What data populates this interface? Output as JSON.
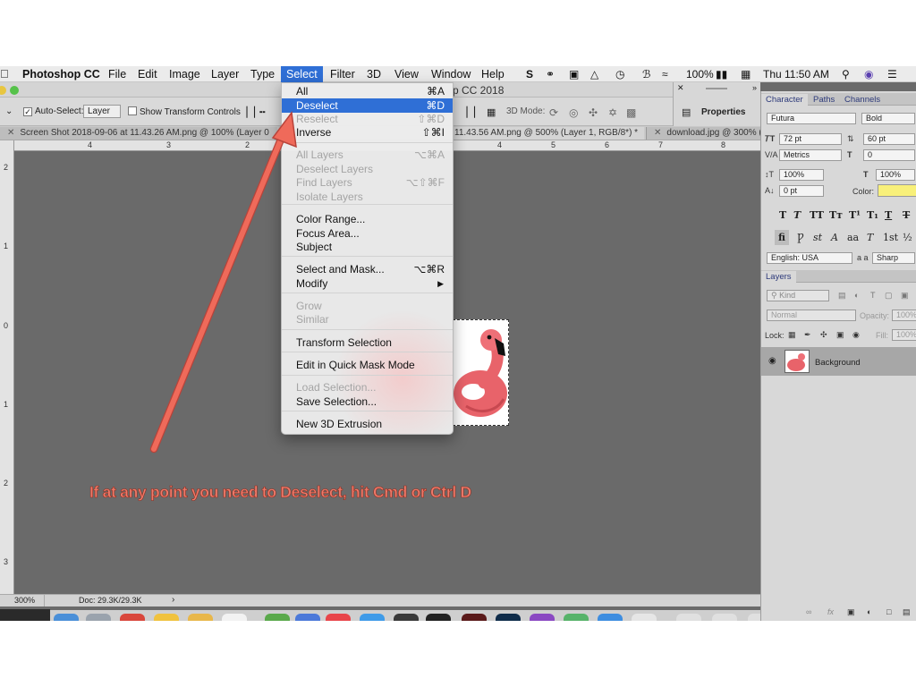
{
  "menubar": {
    "app_name": "Photoshop CC",
    "items": [
      "File",
      "Edit",
      "Image",
      "Layer",
      "Type",
      "Select",
      "Filter",
      "3D",
      "View",
      "Window",
      "Help"
    ],
    "battery": "100%",
    "clock": "Thu 11:50 AM"
  },
  "window": {
    "title_fragment": "p CC 2018"
  },
  "options_bar": {
    "auto_select_label": "Auto-Select:",
    "auto_select_value": "Layer",
    "show_transform_label": "Show Transform Controls",
    "mode_3d_label": "3D Mode:"
  },
  "tabs": [
    {
      "label": "Screen Shot 2018-09-06 at 11.43.26 AM.png @ 100% (Layer 0"
    },
    {
      "label": "11.43.56 AM.png @ 500% (Layer 1, RGB/8*) *"
    },
    {
      "label": "download.jpg @ 300% ("
    }
  ],
  "ruler": {
    "top_ticks": [
      "4",
      "3",
      "2",
      "4",
      "5",
      "6",
      "7",
      "8"
    ],
    "left_ticks": [
      "2",
      "1",
      "0",
      "1",
      "2",
      "3"
    ]
  },
  "properties_panel": {
    "label": "Properties"
  },
  "select_menu": {
    "items": [
      {
        "label": "All",
        "shortcut": "⌘A",
        "state": "normal"
      },
      {
        "label": "Deselect",
        "shortcut": "⌘D",
        "state": "highlighted"
      },
      {
        "label": "Reselect",
        "shortcut": "⇧⌘D",
        "state": "disabled"
      },
      {
        "label": "Inverse",
        "shortcut": "⇧⌘I",
        "state": "normal"
      },
      {
        "label": "All Layers",
        "shortcut": "⌥⌘A",
        "state": "disabled"
      },
      {
        "label": "Deselect Layers",
        "shortcut": "",
        "state": "disabled"
      },
      {
        "label": "Find Layers",
        "shortcut": "⌥⇧⌘F",
        "state": "disabled"
      },
      {
        "label": "Isolate Layers",
        "shortcut": "",
        "state": "disabled"
      },
      {
        "label": "Color Range...",
        "shortcut": "",
        "state": "normal"
      },
      {
        "label": "Focus Area...",
        "shortcut": "",
        "state": "normal"
      },
      {
        "label": "Subject",
        "shortcut": "",
        "state": "normal"
      },
      {
        "label": "Select and Mask...",
        "shortcut": "⌥⌘R",
        "state": "normal"
      },
      {
        "label": "Modify",
        "shortcut": "",
        "state": "submenu"
      },
      {
        "label": "Grow",
        "shortcut": "",
        "state": "disabled"
      },
      {
        "label": "Similar",
        "shortcut": "",
        "state": "disabled"
      },
      {
        "label": "Transform Selection",
        "shortcut": "",
        "state": "normal"
      },
      {
        "label": "Edit in Quick Mask Mode",
        "shortcut": "",
        "state": "normal"
      },
      {
        "label": "Load Selection...",
        "shortcut": "",
        "state": "disabled"
      },
      {
        "label": "Save Selection...",
        "shortcut": "",
        "state": "normal"
      },
      {
        "label": "New 3D Extrusion",
        "shortcut": "",
        "state": "normal"
      }
    ]
  },
  "character_panel": {
    "tabs": [
      "Character",
      "Paths",
      "Channels"
    ],
    "font_family": "Futura",
    "font_style": "Bold",
    "font_size": "72 pt",
    "leading": "60 pt",
    "kerning": "Metrics",
    "tracking": "0",
    "vertical_scale": "100%",
    "horizontal_scale": "100%",
    "baseline_shift": "0 pt",
    "color_label": "Color:",
    "color_value": "#f8f07a",
    "language": "English: USA",
    "aa_label": "a a",
    "antialias": "Sharp"
  },
  "layers_panel": {
    "title": "Layers",
    "filter_label": "Kind",
    "blend_mode": "Normal",
    "opacity_label": "Opacity:",
    "opacity_value": "100%",
    "lock_label": "Lock:",
    "fill_label": "Fill:",
    "fill_value": "100%",
    "layer_name": "Background"
  },
  "status_bar": {
    "zoom": "300%",
    "doc_size": "Doc: 29.3K/29.3K"
  },
  "annotation": {
    "text": "If at any point you need to Deselect, hit Cmd or Ctrl D",
    "color": "#f07a6a"
  },
  "colors": {
    "menu_highlight": "#2f6fd6",
    "canvas_bg": "#6a6a6a",
    "arrow": "#ef6a5a"
  }
}
